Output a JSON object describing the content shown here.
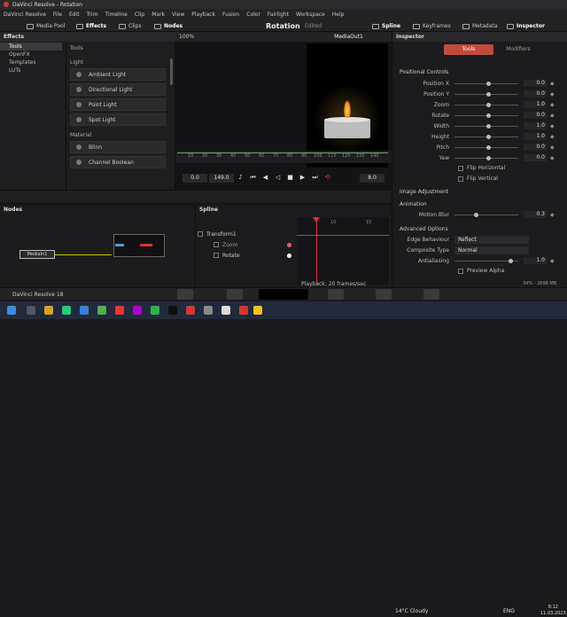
{
  "window": {
    "title": "DaVinci Resolve - Rotation"
  },
  "menu": [
    "DaVinci Resolve",
    "File",
    "Edit",
    "Trim",
    "Timeline",
    "Clip",
    "Mark",
    "View",
    "Playback",
    "Fusion",
    "Color",
    "Fairlight",
    "Workspace",
    "Help"
  ],
  "toolbar": {
    "media_pool": "Media Pool",
    "effects": "Effects",
    "clips": "Clips",
    "nodes": "Nodes",
    "spline": "Spline",
    "keyframes": "Keyframes",
    "metadata": "Metadata",
    "inspector": "Inspector"
  },
  "project": {
    "title": "Rotation",
    "status": "Edited"
  },
  "effects_panel": {
    "title": "Effects",
    "tree": [
      "Tools",
      "OpenFX",
      "Templates",
      "LUTs"
    ],
    "tools_header": "Tools",
    "sections": [
      {
        "name": "Light",
        "items": [
          "Ambient Light",
          "Directional Light",
          "Point Light",
          "Spot Light"
        ]
      },
      {
        "name": "Material",
        "items": [
          "Blinn",
          "Channel Boolean"
        ]
      }
    ]
  },
  "viewer": {
    "zoom": "100%",
    "output": "MediaOut1",
    "ruler_ticks": [
      "10",
      "20",
      "30",
      "40",
      "50",
      "60",
      "70",
      "80",
      "90",
      "100",
      "110",
      "120",
      "130",
      "140"
    ],
    "current_frame": "0.0",
    "end_frame": "149.0",
    "frame_value": "8.0"
  },
  "inspector": {
    "title": "Inspector",
    "tabs": [
      "Tools",
      "Modifiers"
    ],
    "transform_section": "Positional Controls",
    "properties": [
      {
        "label": "Position X",
        "value": "0.0",
        "knob": 0.5
      },
      {
        "label": "Position Y",
        "value": "0.0",
        "knob": 0.5
      },
      {
        "label": "Zoom",
        "value": "1.0",
        "knob": 0.5
      },
      {
        "label": "Rotate",
        "value": "0.0",
        "knob": 0.5
      },
      {
        "label": "Width",
        "value": "1.0",
        "knob": 0.5
      },
      {
        "label": "Height",
        "value": "1.0",
        "knob": 0.5
      },
      {
        "label": "Pitch",
        "value": "0.0",
        "knob": 0.5
      },
      {
        "label": "Yaw",
        "value": "0.0",
        "knob": 0.5
      }
    ],
    "flip_h": "Flip Horizontal",
    "flip_v": "Flip Vertical",
    "image_adjustment": "Image Adjustment",
    "animation": "Animation",
    "motion_blur": {
      "label": "Motion Blur",
      "value": "0.3",
      "knob": 0.3
    },
    "advanced": "Advanced Options",
    "edge_behaviour": {
      "label": "Edge Behaviour",
      "value": "Reflect"
    },
    "composite_type": {
      "label": "Composite Type",
      "value": "Normal"
    },
    "antialiasing": {
      "label": "Antialiasing",
      "value": "1.0",
      "knob": 0.85
    },
    "preview_alpha": "Preview Alpha"
  },
  "nodes_panel": {
    "title": "Nodes",
    "node_label": "MediaIn1"
  },
  "spline_panel": {
    "title": "Spline",
    "tree": [
      {
        "label": "Transform1",
        "color": "#dddddd"
      },
      {
        "label": "Zoom",
        "color": "#e06060"
      },
      {
        "label": "Rotate",
        "color": "#ffffff"
      }
    ],
    "graph_ticks": [
      "10",
      "15"
    ]
  },
  "status": {
    "playback": "Playback: 20 frames/sec",
    "memory": "34% - 2698 MB",
    "brand": "DaVinci Resolve 18"
  },
  "taskbar": {
    "weather": "14°C  Cloudy",
    "lang": "ENG",
    "time": "8:12",
    "date": "11.03.2023"
  }
}
